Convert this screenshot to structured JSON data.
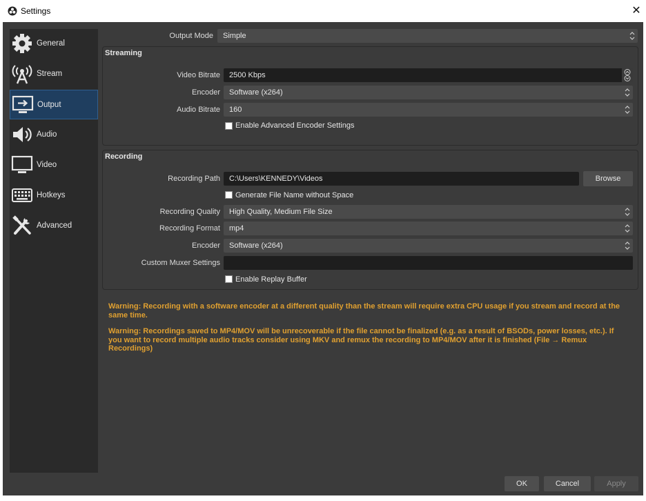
{
  "window": {
    "title": "Settings"
  },
  "sidebar": {
    "items": [
      {
        "label": "General",
        "icon": "gear-icon"
      },
      {
        "label": "Stream",
        "icon": "broadcast-antenna-icon"
      },
      {
        "label": "Output",
        "icon": "monitor-output-icon",
        "active": true
      },
      {
        "label": "Audio",
        "icon": "speaker-icon"
      },
      {
        "label": "Video",
        "icon": "monitor-icon"
      },
      {
        "label": "Hotkeys",
        "icon": "keyboard-icon"
      },
      {
        "label": "Advanced",
        "icon": "tools-icon"
      }
    ]
  },
  "output_mode": {
    "label": "Output Mode",
    "value": "Simple"
  },
  "streaming": {
    "title": "Streaming",
    "video_bitrate": {
      "label": "Video Bitrate",
      "value": "2500 Kbps"
    },
    "encoder": {
      "label": "Encoder",
      "value": "Software (x264)"
    },
    "audio_bitrate": {
      "label": "Audio Bitrate",
      "value": "160"
    },
    "advanced_encoder": {
      "label": "Enable Advanced Encoder Settings",
      "checked": false
    }
  },
  "recording": {
    "title": "Recording",
    "path": {
      "label": "Recording Path",
      "value": "C:\\Users\\KENNEDY\\Videos"
    },
    "browse_label": "Browse",
    "generate_name": {
      "label": "Generate File Name without Space",
      "checked": false
    },
    "quality": {
      "label": "Recording Quality",
      "value": "High Quality, Medium File Size"
    },
    "format": {
      "label": "Recording Format",
      "value": "mp4"
    },
    "encoder": {
      "label": "Encoder",
      "value": "Software (x264)"
    },
    "muxer": {
      "label": "Custom Muxer Settings",
      "value": ""
    },
    "replay_buffer": {
      "label": "Enable Replay Buffer",
      "checked": false
    }
  },
  "warnings": {
    "cpu": "Warning: Recording with a software encoder at a different quality than the stream will require extra CPU usage if you stream and record at the same time.",
    "mp4": "Warning: Recordings saved to MP4/MOV will be unrecoverable if the file cannot be finalized (e.g. as a result of BSODs, power losses, etc.). If you want to record multiple audio tracks consider using MKV and remux the recording to MP4/MOV after it is finished (File → Remux Recordings)"
  },
  "footer": {
    "ok": "OK",
    "cancel": "Cancel",
    "apply": "Apply"
  },
  "colors": {
    "warning": "#e0a030",
    "background": "#3b3b3b",
    "sidebar": "#2a2a2a",
    "active": "#1f3e5f"
  }
}
